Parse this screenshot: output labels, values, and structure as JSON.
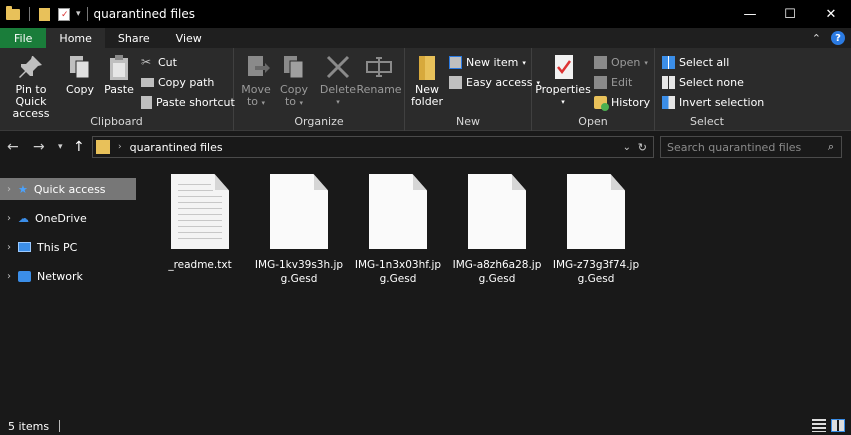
{
  "window": {
    "title": "quarantined files",
    "minimize": "—",
    "maximize": "☐",
    "close": "✕"
  },
  "tabs": [
    {
      "label": "File"
    },
    {
      "label": "Home"
    },
    {
      "label": "Share"
    },
    {
      "label": "View"
    }
  ],
  "ribbon": {
    "clipboard": {
      "label": "Clipboard",
      "pin": "Pin to Quick access",
      "pin_line1": "Pin to Quick",
      "pin_line2": "access",
      "copy": "Copy",
      "paste": "Paste",
      "cut": "Cut",
      "copy_path": "Copy path",
      "paste_shortcut": "Paste shortcut"
    },
    "organize": {
      "label": "Organize",
      "move_line1": "Move",
      "move_line2": "to",
      "copy_line1": "Copy",
      "copy_line2": "to",
      "delete": "Delete",
      "rename": "Rename"
    },
    "new": {
      "label": "New",
      "folder_line1": "New",
      "folder_line2": "folder",
      "new_item": "New item",
      "easy_access": "Easy access"
    },
    "open": {
      "label": "Open",
      "properties": "Properties",
      "open": "Open",
      "edit": "Edit",
      "history": "History"
    },
    "select": {
      "label": "Select",
      "select_all": "Select all",
      "select_none": "Select none",
      "invert": "Invert selection"
    }
  },
  "address": {
    "path": "quarantined files",
    "search_placeholder": "Search quarantined files"
  },
  "navpane": [
    {
      "label": "Quick access",
      "icon": "star-icon"
    },
    {
      "label": "OneDrive",
      "icon": "cloud-icon"
    },
    {
      "label": "This PC",
      "icon": "computer-icon"
    },
    {
      "label": "Network",
      "icon": "network-icon"
    }
  ],
  "files": [
    {
      "name": "_readme.txt",
      "type": "text"
    },
    {
      "name": "IMG-1kv39s3h.jpg.Gesd",
      "type": "generic"
    },
    {
      "name": "IMG-1n3x03hf.jpg.Gesd",
      "type": "generic"
    },
    {
      "name": "IMG-a8zh6a28.jpg.Gesd",
      "type": "generic"
    },
    {
      "name": "IMG-z73g3f74.jpg.Gesd",
      "type": "generic"
    }
  ],
  "status": {
    "count": "5 items"
  },
  "colors": {
    "file_tab": "#1a7d3a",
    "selected_nav": "#777777",
    "accent": "#2b7be3",
    "folder": "#e8c15a"
  }
}
